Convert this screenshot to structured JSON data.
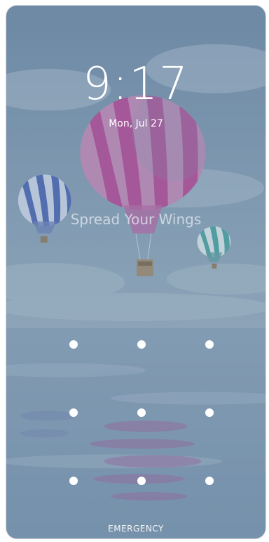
{
  "lockscreen": {
    "time": "9:17",
    "date": "Mon, Jul 27",
    "owner_text": "Spread Your Wings",
    "emergency_label": "EMERGENCY",
    "pattern_dots": [
      {
        "id": "pattern-dot-1"
      },
      {
        "id": "pattern-dot-2"
      },
      {
        "id": "pattern-dot-3"
      },
      {
        "id": "pattern-dot-4"
      },
      {
        "id": "pattern-dot-5"
      },
      {
        "id": "pattern-dot-6"
      },
      {
        "id": "pattern-dot-7"
      },
      {
        "id": "pattern-dot-8"
      },
      {
        "id": "pattern-dot-9"
      }
    ]
  },
  "colors": {
    "sky": "#7b95ad",
    "balloon_pink": "#b5579a",
    "balloon_blue": "#5a73b5",
    "balloon_teal": "#5fa9a8"
  }
}
